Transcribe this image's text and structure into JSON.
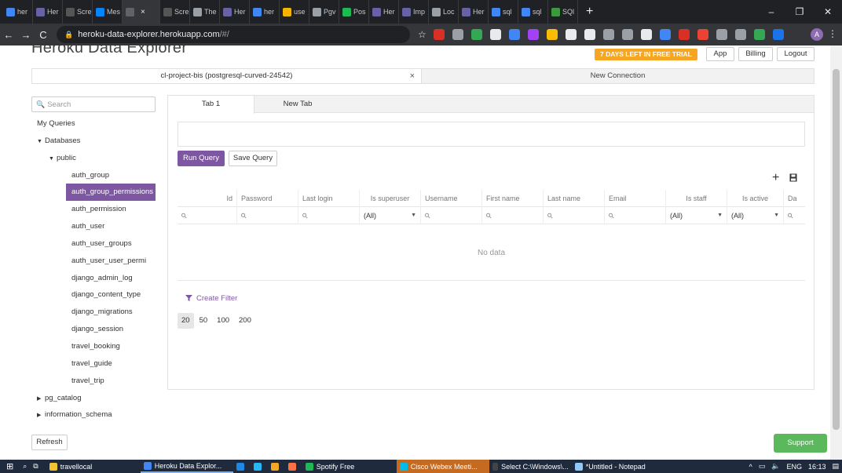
{
  "browser": {
    "tabs": [
      {
        "label": "her",
        "color": "#4285f4"
      },
      {
        "label": "Her",
        "color": "#6762a6"
      },
      {
        "label": "Scre",
        "color": "#555555"
      },
      {
        "label": "Mes",
        "color": "#0084ff"
      },
      {
        "label": "",
        "color": "#5f6368",
        "active": true
      },
      {
        "label": "Scre",
        "color": "#555555"
      },
      {
        "label": "The",
        "color": "#9aa0a6"
      },
      {
        "label": "Her",
        "color": "#6762a6"
      },
      {
        "label": "her",
        "color": "#4285f4"
      },
      {
        "label": "use",
        "color": "#f4b400"
      },
      {
        "label": "Pgv",
        "color": "#9aa0a6"
      },
      {
        "label": "Pos",
        "color": "#1db954"
      },
      {
        "label": "Her",
        "color": "#6762a6"
      },
      {
        "label": "Imp",
        "color": "#6762a6"
      },
      {
        "label": "Loc",
        "color": "#9aa0a6"
      },
      {
        "label": "Her",
        "color": "#6762a6"
      },
      {
        "label": "sql",
        "color": "#4285f4"
      },
      {
        "label": "sql",
        "color": "#4285f4"
      },
      {
        "label": "SQl",
        "color": "#3c9a3c"
      }
    ],
    "active_close": "×",
    "new_tab": "+",
    "window": {
      "minimize": "–",
      "restore": "❐",
      "close": "✕"
    },
    "url_host": "heroku-data-explorer.herokuapp.com",
    "url_path": "/#/",
    "profile_initial": "A"
  },
  "header": {
    "brand": "Heroku Data Explorer",
    "trial": "7 DAYS LEFT IN FREE TRIAL",
    "app": "App",
    "billing": "Billing",
    "logout": "Logout"
  },
  "connections": {
    "current": "cl-project-bis (postgresql-curved-24542)",
    "close": "×",
    "new": "New Connection"
  },
  "sidebar": {
    "search_placeholder": "Search",
    "my_queries": "My Queries",
    "databases": "Databases",
    "public": "public",
    "tables": [
      "auth_group",
      "auth_group_permissions",
      "auth_permission",
      "auth_user",
      "auth_user_groups",
      "auth_user_user_permi",
      "django_admin_log",
      "django_content_type",
      "django_migrations",
      "django_session",
      "travel_booking",
      "travel_guide",
      "travel_trip"
    ],
    "selected_index": 1,
    "pg_catalog": "pg_catalog",
    "information_schema": "information_schema",
    "refresh": "Refresh"
  },
  "query": {
    "tabs": [
      "Tab 1",
      "New Tab"
    ],
    "run": "Run Query",
    "save": "Save Query",
    "add": "+"
  },
  "grid": {
    "columns": [
      {
        "label": "Id",
        "align": "r",
        "filter": "search"
      },
      {
        "label": "Password",
        "align": "l",
        "filter": "search"
      },
      {
        "label": "Last login",
        "align": "l",
        "filter": "search"
      },
      {
        "label": "Is superuser",
        "align": "m",
        "filter": "select",
        "value": "(All)"
      },
      {
        "label": "Username",
        "align": "l",
        "filter": "search"
      },
      {
        "label": "First name",
        "align": "l",
        "filter": "search"
      },
      {
        "label": "Last name",
        "align": "l",
        "filter": "search"
      },
      {
        "label": "Email",
        "align": "l",
        "filter": "search"
      },
      {
        "label": "Is staff",
        "align": "m",
        "filter": "select",
        "value": "(All)"
      },
      {
        "label": "Is active",
        "align": "m",
        "filter": "select",
        "value": "(All)"
      },
      {
        "label": "Da",
        "align": "l",
        "filter": "search"
      }
    ],
    "empty": "No data",
    "create_filter": "Create Filter",
    "page_sizes": [
      "20",
      "50",
      "100",
      "200"
    ],
    "page_size_selected": 0
  },
  "support": "Support",
  "taskbar": {
    "items": [
      {
        "label": "travellocal",
        "color": "#f4c430"
      },
      {
        "label": "Heroku Data Explor...",
        "color": "#4285f4",
        "app": true
      },
      {
        "label": "",
        "color": "#1e88e5"
      },
      {
        "label": "",
        "color": "#29b6f6"
      },
      {
        "label": "",
        "color": "#f5a623"
      },
      {
        "label": "",
        "color": "#ff7043"
      },
      {
        "label": "Spotify Free",
        "color": "#1db954"
      },
      {
        "label": "Cisco Webex Meeti...",
        "color": "#00bceb",
        "highlight": true
      },
      {
        "label": "Select C:\\Windows\\...",
        "color": "#444444"
      },
      {
        "label": "*Untitled - Notepad",
        "color": "#90caf9"
      }
    ],
    "language": "ENG",
    "time": "16:13"
  }
}
